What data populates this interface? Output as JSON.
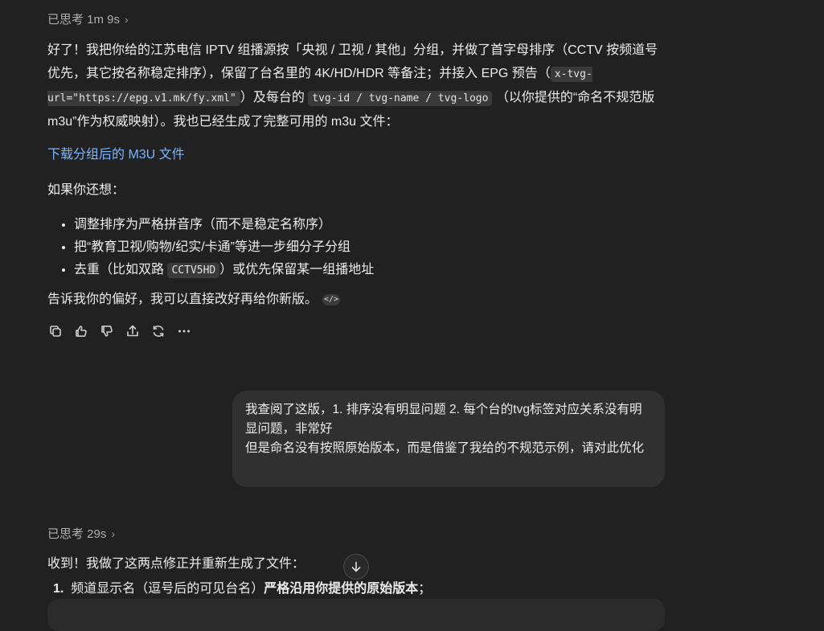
{
  "thought1": {
    "label": "已思考 1m 9s"
  },
  "answer": {
    "p1_a": "好了！我把你给的江苏电信 IPTV 组播源按「央视 / 卫视 / 其他」分组，并做了首字母排序（CCTV 按频道号优先，其它按名称稳定排序），保留了台名里的 4K/HD/HDR 等备注；并接入 EPG 预告（",
    "p1_code1": "x-tvg-url=\"https://epg.v1.mk/fy.xml\"",
    "p1_b": "）及每台的",
    "p1_code2": "tvg-id / tvg-name / tvg-logo",
    "p1_c": "（以你提供的“命名不规范版 m3u”作为权威映射）。我也已经生成了完整可用的 m3u 文件：",
    "download_link": "下载分组后的 M3U 文件",
    "more_intro": "如果你还想：",
    "bullets": {
      "b1": "调整排序为严格拼音序（而不是稳定名称序）",
      "b2": "把“教育卫视/购物/纪实/卡通”等进一步细分子分组",
      "b3_a": "去重（比如双路",
      "b3_code": "CCTV5HD",
      "b3_b": "）或优先保留某一组播地址"
    },
    "closing": "告诉我你的偏好，我可以直接改好再给你新版。",
    "chip": "</>"
  },
  "actions": {
    "copy": "copy-icon",
    "like": "thumbs-up-icon",
    "dislike": "thumbs-down-icon",
    "share": "share-icon",
    "regenerate": "regenerate-icon",
    "more": "more-icon"
  },
  "user_message": {
    "line1": "我查阅了这版，1. 排序没有明显问题 2. 每个台的tvg标签对应关系没有明显问题，非常好",
    "line2": "但是命名没有按照原始版本，而是借鉴了我给的不规范示例，请对此优化"
  },
  "thought2": {
    "label": "已思考 29s"
  },
  "answer2": {
    "intro": "收到！我做了这两点修正并重新生成了文件：",
    "item1_num": "1.",
    "item1_a": "频道显示名（逗号后的可见台名）",
    "item1_bold": "严格沿用你提供的原始版本",
    "item1_b": "；"
  }
}
